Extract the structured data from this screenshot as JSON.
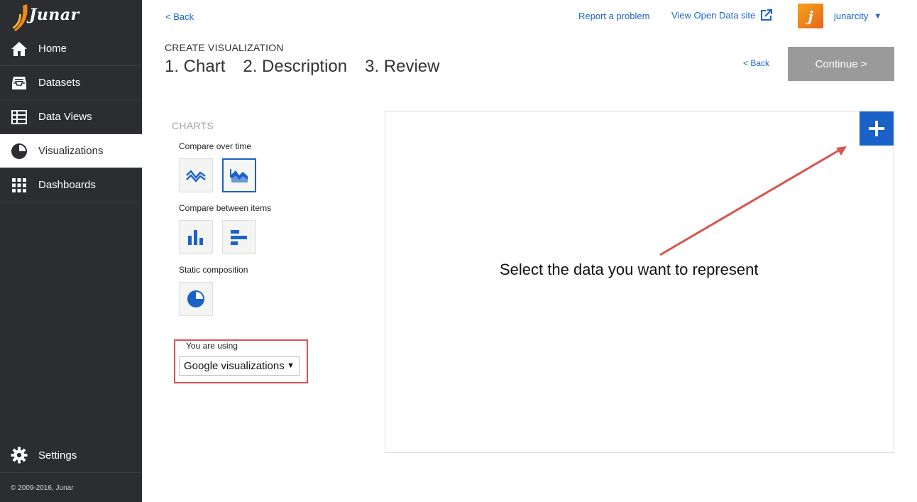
{
  "sidebar": {
    "logo": "Junar",
    "items": [
      {
        "label": "Home",
        "icon": "home-icon"
      },
      {
        "label": "Datasets",
        "icon": "inbox-icon"
      },
      {
        "label": "Data Views",
        "icon": "table-icon"
      },
      {
        "label": "Visualizations",
        "icon": "pie-chart-icon",
        "active": true
      },
      {
        "label": "Dashboards",
        "icon": "grid-icon"
      }
    ],
    "settings": "Settings",
    "copyright": "© 2009-2016, Junar"
  },
  "topbar": {
    "back": "< Back",
    "report": "Report a problem",
    "open_data": "View Open Data site",
    "avatar_letter": "j",
    "username": "junarcity",
    "caret": "▼"
  },
  "wizard": {
    "heading": "CREATE VISUALIZATION",
    "steps": [
      "1. Chart",
      "2. Description",
      "3. Review"
    ],
    "back": "< Back",
    "continue": "Continue >"
  },
  "charts": {
    "heading": "CHARTS",
    "groups": [
      {
        "label": "Compare over time",
        "types": [
          "line-chart-icon",
          "area-chart-icon"
        ],
        "selected": "area-chart-icon"
      },
      {
        "label": "Compare between items",
        "types": [
          "column-chart-icon",
          "bar-chart-icon"
        ]
      },
      {
        "label": "Static composition",
        "types": [
          "pie-chart-icon"
        ]
      }
    ],
    "using_label": "You are using",
    "library": "Google visualizations",
    "library_caret": "▼"
  },
  "canvas": {
    "hint": "Select the data you want to represent",
    "add_icon": "plus-icon"
  },
  "colors": {
    "sidebar_bg": "#2b2d30",
    "accent": "#1a62c8",
    "continue_disabled": "#9a9a9a",
    "highlight": "#d9534f",
    "avatar": "#f08a1e"
  }
}
